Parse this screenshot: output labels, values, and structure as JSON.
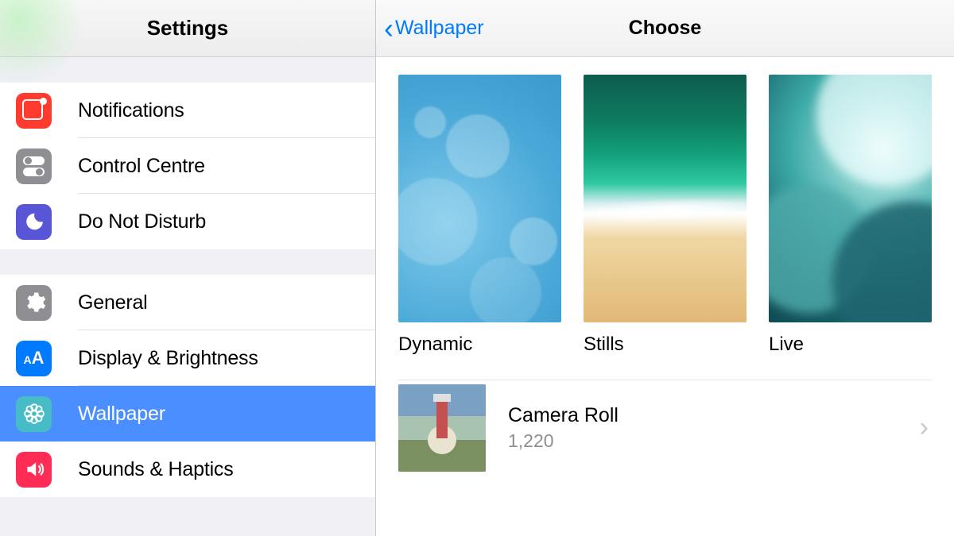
{
  "left": {
    "title": "Settings",
    "group1": [
      {
        "label": "Notifications"
      },
      {
        "label": "Control Centre"
      },
      {
        "label": "Do Not Disturb"
      }
    ],
    "group2": [
      {
        "label": "General"
      },
      {
        "label": "Display & Brightness"
      },
      {
        "label": "Wallpaper",
        "selected": true
      },
      {
        "label": "Sounds & Haptics"
      }
    ]
  },
  "right": {
    "back_label": "Wallpaper",
    "title": "Choose",
    "categories": [
      {
        "label": "Dynamic"
      },
      {
        "label": "Stills"
      },
      {
        "label": "Live"
      }
    ],
    "album": {
      "name": "Camera Roll",
      "count": "1,220"
    }
  }
}
